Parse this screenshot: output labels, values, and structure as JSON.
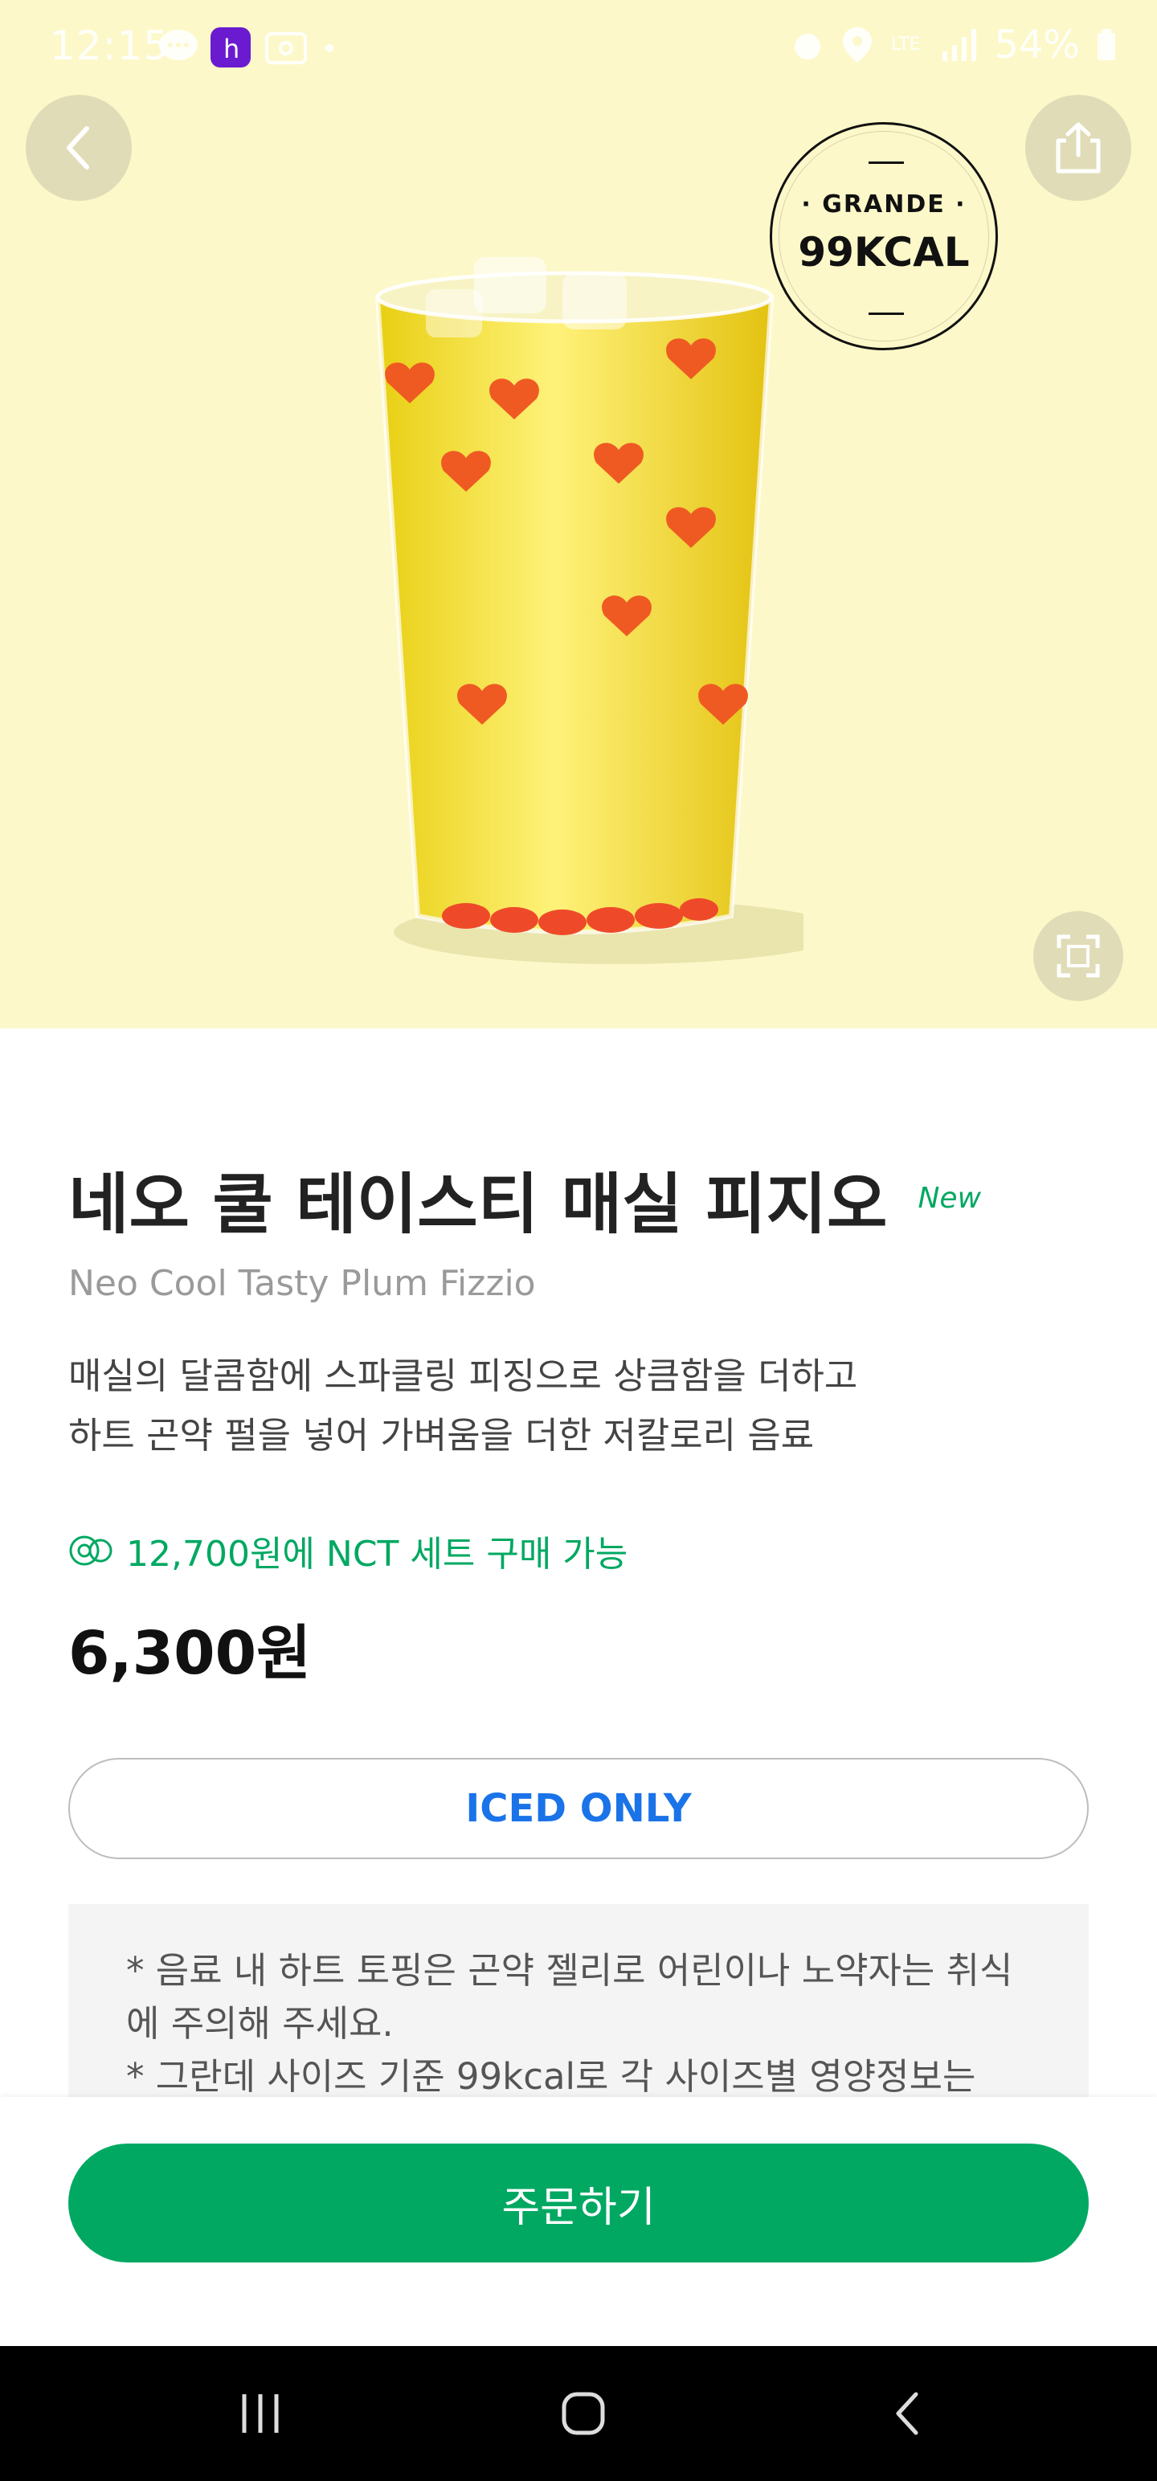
{
  "status_bar": {
    "time": "12:15",
    "battery": "54%"
  },
  "hero": {
    "kcal_size": "· GRANDE ·",
    "kcal_value": "99KCAL"
  },
  "product": {
    "name_ko": "네오 쿨 테이스티 매실 피지오",
    "new_badge": "New",
    "name_en": "Neo Cool Tasty Plum Fizzio",
    "description": "매실의 달콤함에 스파클링 피징으로 상큼함을 더하고\n하트 곤약 펄을 넣어 가벼움을 더한 저칼로리 음료",
    "set_offer": "12,700원에 NCT 세트 구매 가능",
    "price": "6,300원",
    "temperature_option": "ICED ONLY",
    "notices": [
      "* 음료 내 하트 토핑은 곤약 젤리로 어린이나 노약자는 취식에 주의해 주세요.",
      "* 그란데 사이즈 기준 99kcal로 각 사이즈별 영양정보는"
    ]
  },
  "order": {
    "button_label": "주문하기"
  },
  "colors": {
    "brand_green": "#00a862",
    "hero_bg": "#fdf8c9",
    "iced_blue": "#1a73e8"
  },
  "icons": [
    "back-icon",
    "share-icon",
    "zoom-icon",
    "set-offer-icon",
    "recent-apps-icon",
    "home-icon",
    "nav-back-icon"
  ]
}
